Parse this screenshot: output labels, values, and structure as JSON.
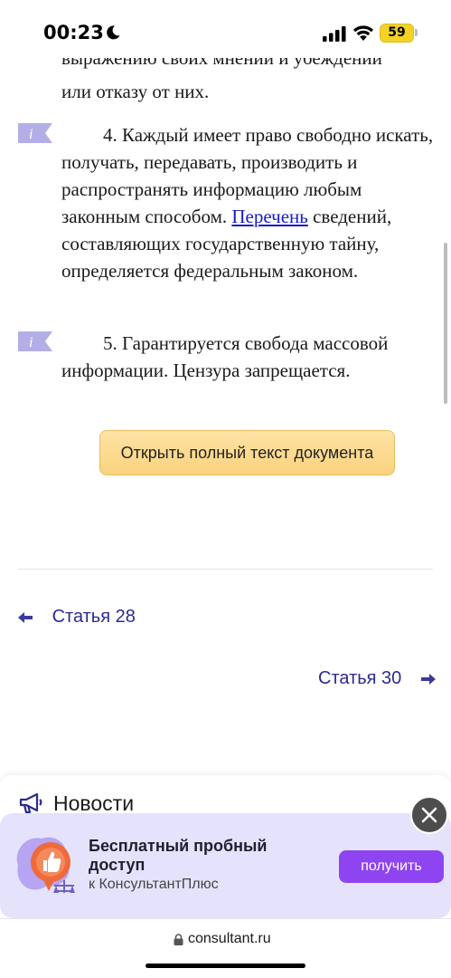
{
  "status_bar": {
    "time": "00:23",
    "battery": "59"
  },
  "article": {
    "cut_line": "выражению своих мнений и убеждений",
    "para3_tail": "или отказу от них.",
    "para4": {
      "text_before_link": "4. Каждый имеет право свободно искать, получать, передавать, производить и распространять информацию любым законным способом.",
      "link_text": "Перечень",
      "text_after_link": "сведений, составляющих государственную тайну, определяется федеральным законом."
    },
    "para5": "5. Гарантируется свобода массовой информации. Цензура запрещается."
  },
  "open_document_button": "Открыть полный текст документа",
  "navigation": {
    "prev_label": "Статья 28",
    "next_label": "Статья 30"
  },
  "news": {
    "title": "Новости"
  },
  "promo": {
    "title": "Бесплатный пробный доступ",
    "subtitle": "к КонсультантПлюс",
    "button_label": "получить"
  },
  "browser": {
    "url": "consultant.ru"
  },
  "colors": {
    "link": "#1a1ac8",
    "nav": "#2b2b8f",
    "accent_purple": "#8e45f1",
    "button_yellow": "#fad27e",
    "promo_bg": "#e5e3fb"
  }
}
